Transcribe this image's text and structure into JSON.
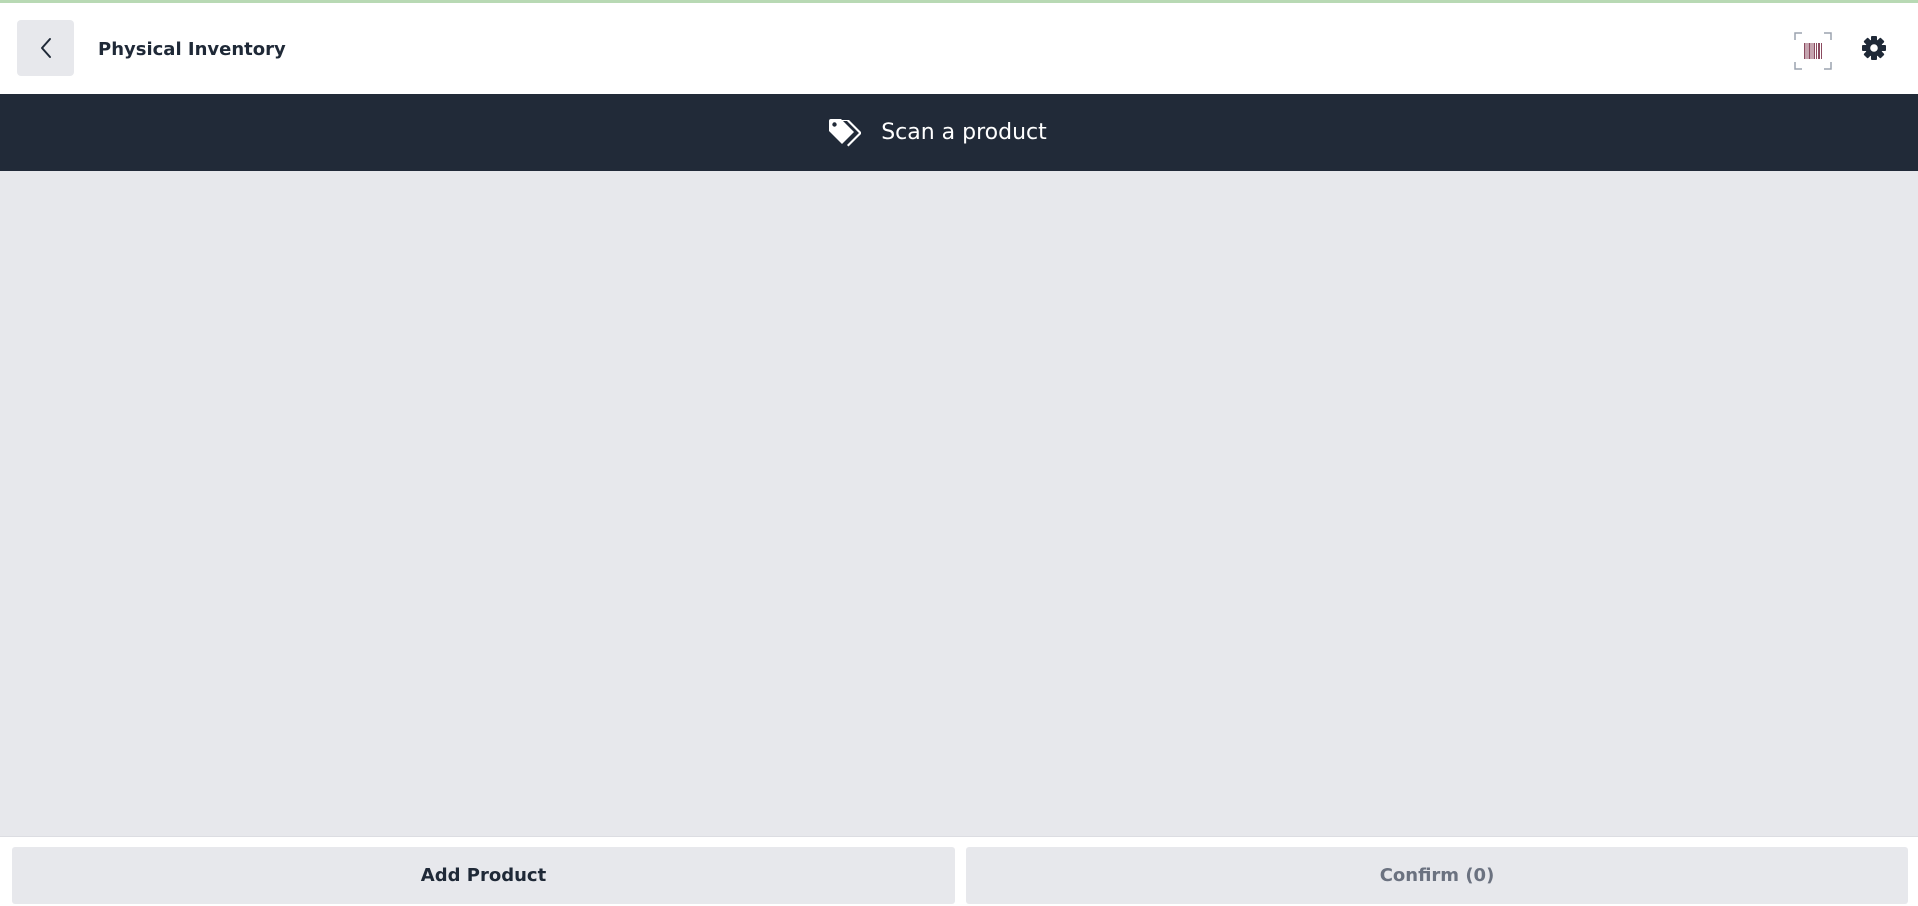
{
  "header": {
    "title": "Physical Inventory",
    "back_icon": "chevron-left-icon",
    "scan_icon": "barcode-scanner-icon",
    "settings_icon": "gear-icon"
  },
  "banner": {
    "text": "Scan a product",
    "icon": "tags-icon"
  },
  "footer": {
    "add_product_label": "Add Product",
    "confirm_label": "Confirm (0)"
  },
  "colors": {
    "top_accent": "#b8d9b4",
    "banner_background": "#212a38",
    "content_background": "#e7e8ec",
    "button_background": "#e7e8ec",
    "title_text": "#1f2937",
    "disabled_text": "#6b7280"
  }
}
